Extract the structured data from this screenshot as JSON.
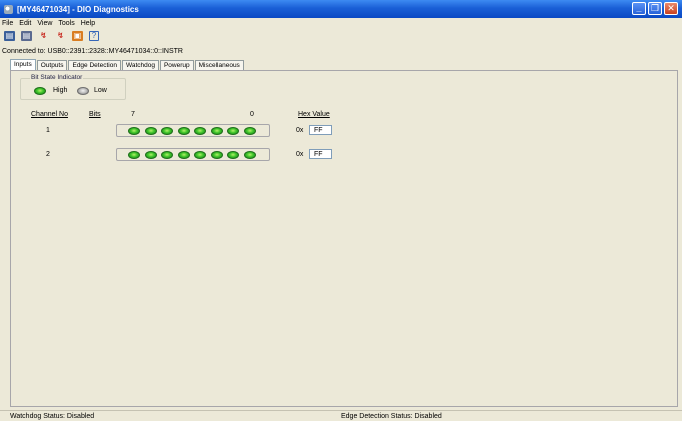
{
  "window": {
    "title": "[MY46471034] - DIO Diagnostics",
    "minimize_glyph": "_",
    "maximize_glyph": "❐",
    "close_glyph": "✕"
  },
  "menu": [
    "File",
    "Edit",
    "View",
    "Tools",
    "Help"
  ],
  "toolbar": {
    "icons": [
      "open-device-icon",
      "close-device-icon",
      "red-connect-icon",
      "red-disconnect-icon",
      "save-icon",
      "help-icon"
    ],
    "help_glyph": "?"
  },
  "connection": {
    "text": "Connected to: USB0::2391::2328::MY46471034::0::INSTR"
  },
  "tabs": [
    {
      "label": "Inputs",
      "active": true
    },
    {
      "label": "Outputs",
      "active": false
    },
    {
      "label": "Edge Detection",
      "active": false
    },
    {
      "label": "Watchdog",
      "active": false
    },
    {
      "label": "Powerup",
      "active": false
    },
    {
      "label": "Miscellaneous",
      "active": false
    }
  ],
  "bit_state_indicator": {
    "title": "Bit State Indicator",
    "high_label": "High",
    "low_label": "Low"
  },
  "table": {
    "headers": {
      "channel_no": "Channel No",
      "bits": "Bits",
      "bit_high_index": "7",
      "bit_low_index": "0",
      "hex_value": "Hex Value"
    },
    "rows": [
      {
        "channel": "1",
        "bits": [
          1,
          1,
          1,
          1,
          1,
          1,
          1,
          1
        ],
        "hex_prefix": "0x",
        "hex": "FF"
      },
      {
        "channel": "2",
        "bits": [
          1,
          1,
          1,
          1,
          1,
          1,
          1,
          1
        ],
        "hex_prefix": "0x",
        "hex": "FF"
      }
    ]
  },
  "status": {
    "watchdog": "Watchdog Status: Disabled",
    "edge_detection": "Edge Detection Status: Disabled"
  },
  "colors": {
    "titlebar": "#1a5fd6",
    "led_high": "#3dc42a",
    "led_low": "#b5b5b5",
    "background": "#ECE9D8"
  }
}
